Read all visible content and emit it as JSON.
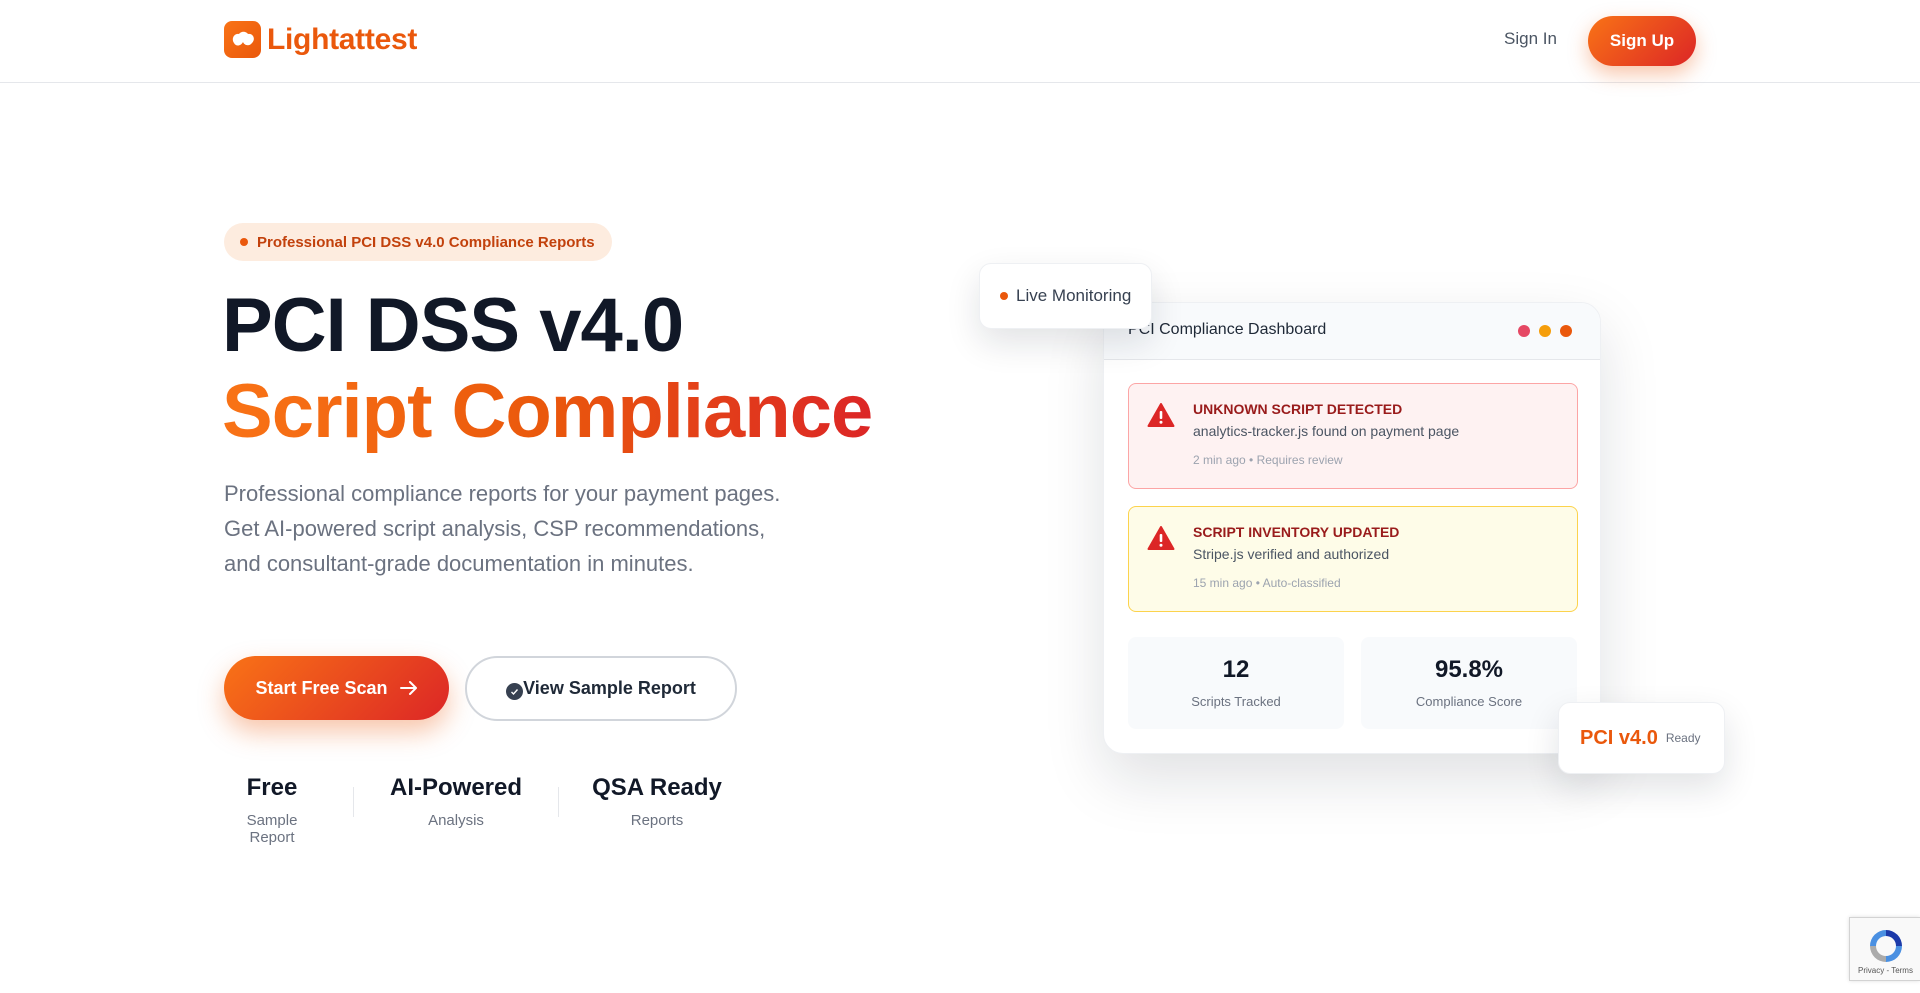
{
  "header": {
    "logo_text": "Lightattest",
    "sign_in": "Sign In",
    "sign_up": "Sign Up"
  },
  "hero": {
    "badge": "Professional PCI DSS v4.0 Compliance Reports",
    "title_line1": "PCI DSS v4.0",
    "title_line2": "Script Compliance",
    "lead": "Professional compliance reports for your payment pages. Get AI-powered script analysis, CSP recommendations, and consultant-grade documentation in minutes.",
    "primary_cta": "Start Free Scan",
    "secondary_cta": "View Sample Report",
    "stats": [
      {
        "value": "Free",
        "label": "Sample Report"
      },
      {
        "value": "AI-Powered",
        "label": "Analysis"
      },
      {
        "value": "QSA Ready",
        "label": "Reports"
      }
    ]
  },
  "dashboard": {
    "title": "PCI Compliance Dashboard",
    "window_dots": [
      "#e54864",
      "#f59e0b",
      "#ea580c"
    ],
    "alerts": [
      {
        "title": "UNKNOWN SCRIPT DETECTED",
        "desc": "analytics-tracker.js found on payment page",
        "meta": "2 min ago • Requires review"
      },
      {
        "title": "SCRIPT INVENTORY UPDATED",
        "desc": "Stripe.js verified and authorized",
        "meta": "15 min ago • Auto-classified"
      }
    ],
    "metrics": [
      {
        "value": "12",
        "label": "Scripts Tracked"
      },
      {
        "value": "95.8%",
        "label": "Compliance Score"
      }
    ]
  },
  "floating": {
    "live": "Live Monitoring",
    "pci_value": "PCI v4.0",
    "pci_label": "Ready"
  },
  "recaptcha": {
    "links": "Privacy - Terms"
  },
  "colors": {
    "brand": "#ea580c",
    "brand_red": "#dc2626",
    "alert_red_text": "#991b1b"
  }
}
